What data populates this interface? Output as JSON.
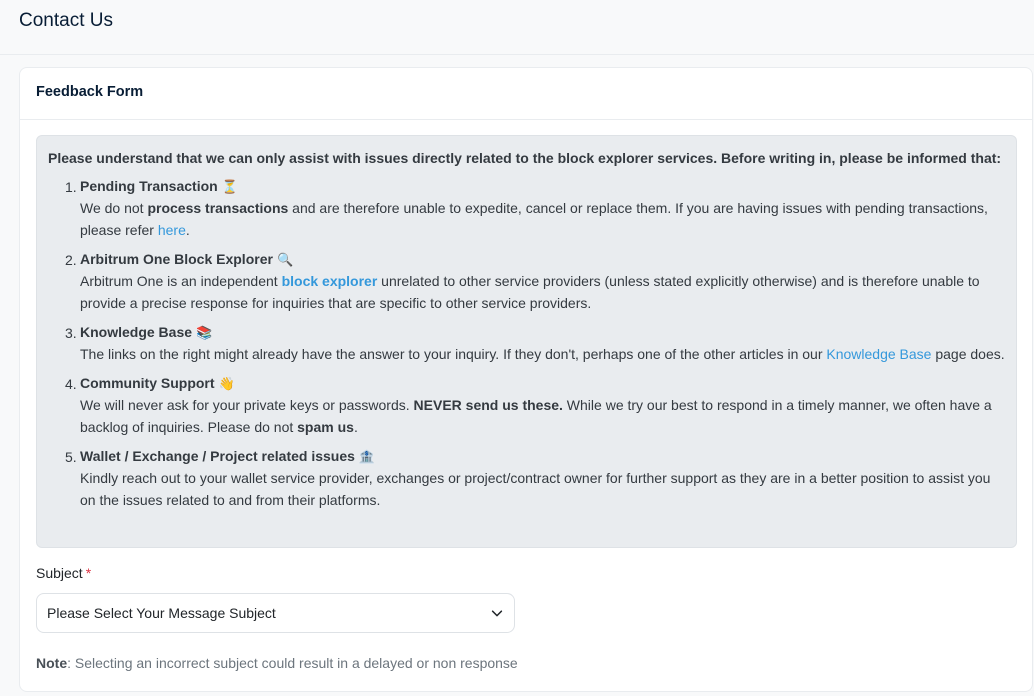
{
  "page": {
    "title": "Contact Us"
  },
  "card": {
    "title": "Feedback Form"
  },
  "notice": {
    "intro": "Please understand that we can only assist with issues directly related to the block explorer services. Before writing in, please be informed that:",
    "items": [
      {
        "num": "1.",
        "title": "Pending Transaction",
        "emoji": "⏳",
        "p1": "We do not ",
        "b1": "process transactions",
        "p2": " and are therefore unable to expedite, cancel or replace them. If you are having issues with pending transactions, please refer ",
        "link": "here",
        "p3": "."
      },
      {
        "num": "2.",
        "title": "Arbitrum One Block Explorer",
        "emoji": "🔍",
        "p1": "Arbitrum One is an independent ",
        "link": "block explorer",
        "p2": " unrelated to other service providers (unless stated explicitly otherwise) and is therefore unable to provide a precise response for inquiries that are specific to other service providers."
      },
      {
        "num": "3.",
        "title": "Knowledge Base",
        "emoji": "📚",
        "p1": "The links on the right might already have the answer to your inquiry. If they don't, perhaps one of the other articles in our ",
        "link": "Knowledge Base",
        "p2": " page does."
      },
      {
        "num": "4.",
        "title": "Community Support",
        "emoji": "👋",
        "p1": "We will never ask for your private keys or passwords. ",
        "b1": "NEVER send us these.",
        "p2": " While we try our best to respond in a timely manner, we often have a backlog of inquiries. Please do not ",
        "b2": "spam us",
        "p3": "."
      },
      {
        "num": "5.",
        "title": "Wallet / Exchange / Project related issues",
        "emoji": "🏦",
        "p1": "Kindly reach out to your wallet service provider, exchanges or project/contract owner for further support as they are in a better position to assist you on the issues related to and from their platforms."
      }
    ]
  },
  "form": {
    "subject_label": "Subject",
    "required_mark": "*",
    "subject_selected": "Please Select Your Message Subject",
    "note_label": "Note",
    "note_text": ": Selecting an incorrect subject could result in a delayed or non response"
  },
  "colors": {
    "link": "#3498db",
    "required": "#dc3545",
    "notice_bg": "#e9ecef"
  }
}
